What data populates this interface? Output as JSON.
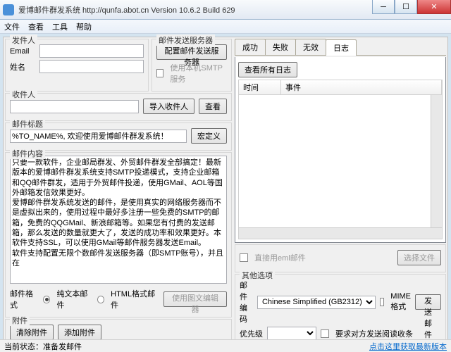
{
  "window": {
    "title": "爱博邮件群发系统 http://qunfa.abot.cn Version 10.6.2 Build 629"
  },
  "menu": {
    "file": "文件",
    "view": "查看",
    "tools": "工具",
    "help": "帮助"
  },
  "sender": {
    "legend": "发件人",
    "email_label": "Email",
    "name_label": "姓名"
  },
  "smtp": {
    "legend": "邮件发送服务器",
    "config_btn": "配置邮件发送服务器",
    "local_cb": "使用本机SMTP服务"
  },
  "recip": {
    "legend": "收件人",
    "import_btn": "导入收件人",
    "view_btn": "查看"
  },
  "subject": {
    "legend": "邮件标题",
    "value": "%TO_NAME%, 欢迎使用爱博邮件群发系统！",
    "macro_btn": "宏定义"
  },
  "body": {
    "legend": "邮件内容",
    "text": "只要一款软件，企业邮局群发、外贸邮件群发全部搞定！最新版本的爱博邮件群发系统支持SMTP投递模式，支持企业邮箱和QQ邮件群发，适用于外贸邮件投递，使用GMail、AOL等国外邮箱发信效果更好。\n爱博邮件群发系统发送的邮件，是使用真实的网络服务器而不是虚拟出来的，使用过程中最好多注册一些免费的SMTP的邮箱，免费的QQGMail、新浪邮箱等。如果您有付费的发送邮箱，那么发送的数量就更大了，发送的成功率和效果更好。本软件支持SSL，可以使用GMail等邮件服务器发送Email。\n软件支持配置无限个数邮件发送服务器（即SMTP账号），并且在"
  },
  "format": {
    "label": "邮件格式",
    "plain": "纯文本邮件",
    "html": "HTML格式邮件",
    "editor_btn": "使用图文编辑器"
  },
  "attach": {
    "legend": "附件",
    "clear_btn": "清除附件",
    "add_btn": "添加附件"
  },
  "tabs": {
    "ok": "成功",
    "fail": "失败",
    "inv": "无效",
    "log": "日志"
  },
  "log": {
    "viewall_btn": "查看所有日志",
    "col_time": "时间",
    "col_event": "事件"
  },
  "eml": {
    "direct_cb": "直接用eml邮件",
    "choose_btn": "选择文件"
  },
  "other": {
    "legend": "其他选项",
    "enc_label": "邮件编码",
    "enc_val": "Chinese Simplified (GB2312)",
    "mime_cb": "MIME格式",
    "prio_label": "优先级",
    "receipt_cb": "要求对方发送阅读收条",
    "send_btn": "发送邮件"
  },
  "status": {
    "label": "当前状态：",
    "value": "准备发邮件",
    "update": "点击这里获取最新版本"
  }
}
